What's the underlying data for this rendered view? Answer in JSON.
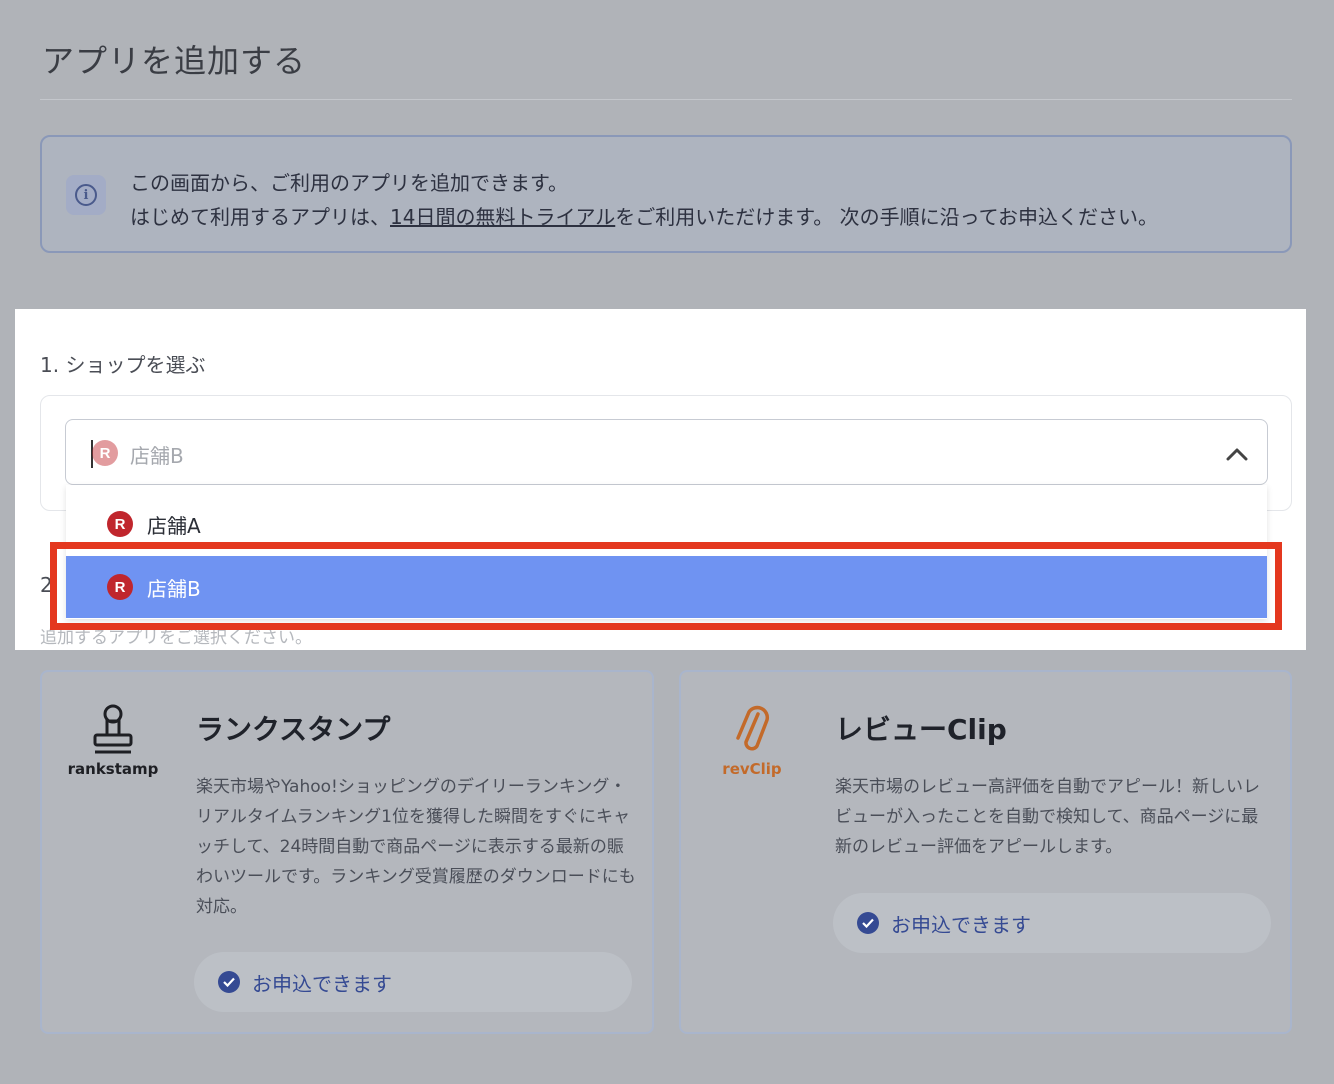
{
  "page": {
    "title": "アプリを追加する"
  },
  "info": {
    "line1": "この画面から、ご利用のアプリを追加できます。",
    "line2_before": "はじめて利用するアプリは、",
    "line2_link": "14日間の無料トライアル",
    "line2_after": "をご利用いただけます。 次の手順に沿ってお申込ください。"
  },
  "step1": {
    "label": "1. ショップを選ぶ",
    "select": {
      "value": "店舗B",
      "options": [
        {
          "label": "店舗A",
          "selected": false
        },
        {
          "label": "店舗B",
          "selected": true
        }
      ]
    }
  },
  "step2": {
    "number": "2",
    "sub": "追加するアプリをご選択ください。"
  },
  "apps": [
    {
      "logo_text": "rankstamp",
      "title": "ランクスタンプ",
      "description": "楽天市場やYahoo!ショッピングのデイリーランキング・リアルタイムランキング1位を獲得した瞬間をすぐにキャッチして、24時間自動で商品ページに表示する最新の賑わいツールです。ランキング受賞履歴のダウンロードにも対応。",
      "status": "お申込できます"
    },
    {
      "logo_text": "revClip",
      "title": "レビューClip",
      "description": "楽天市場のレビュー高評価を自動でアピール！新しいレビューが入ったことを自動で検知して、商品ページに最新のレビュー評価をアピールします。",
      "status": "お申込できます"
    }
  ],
  "colors": {
    "highlight": "#e4381f",
    "selected_option": "#6f93f2",
    "rakuten_red": "#c0262d",
    "status_blue": "#354a93"
  }
}
